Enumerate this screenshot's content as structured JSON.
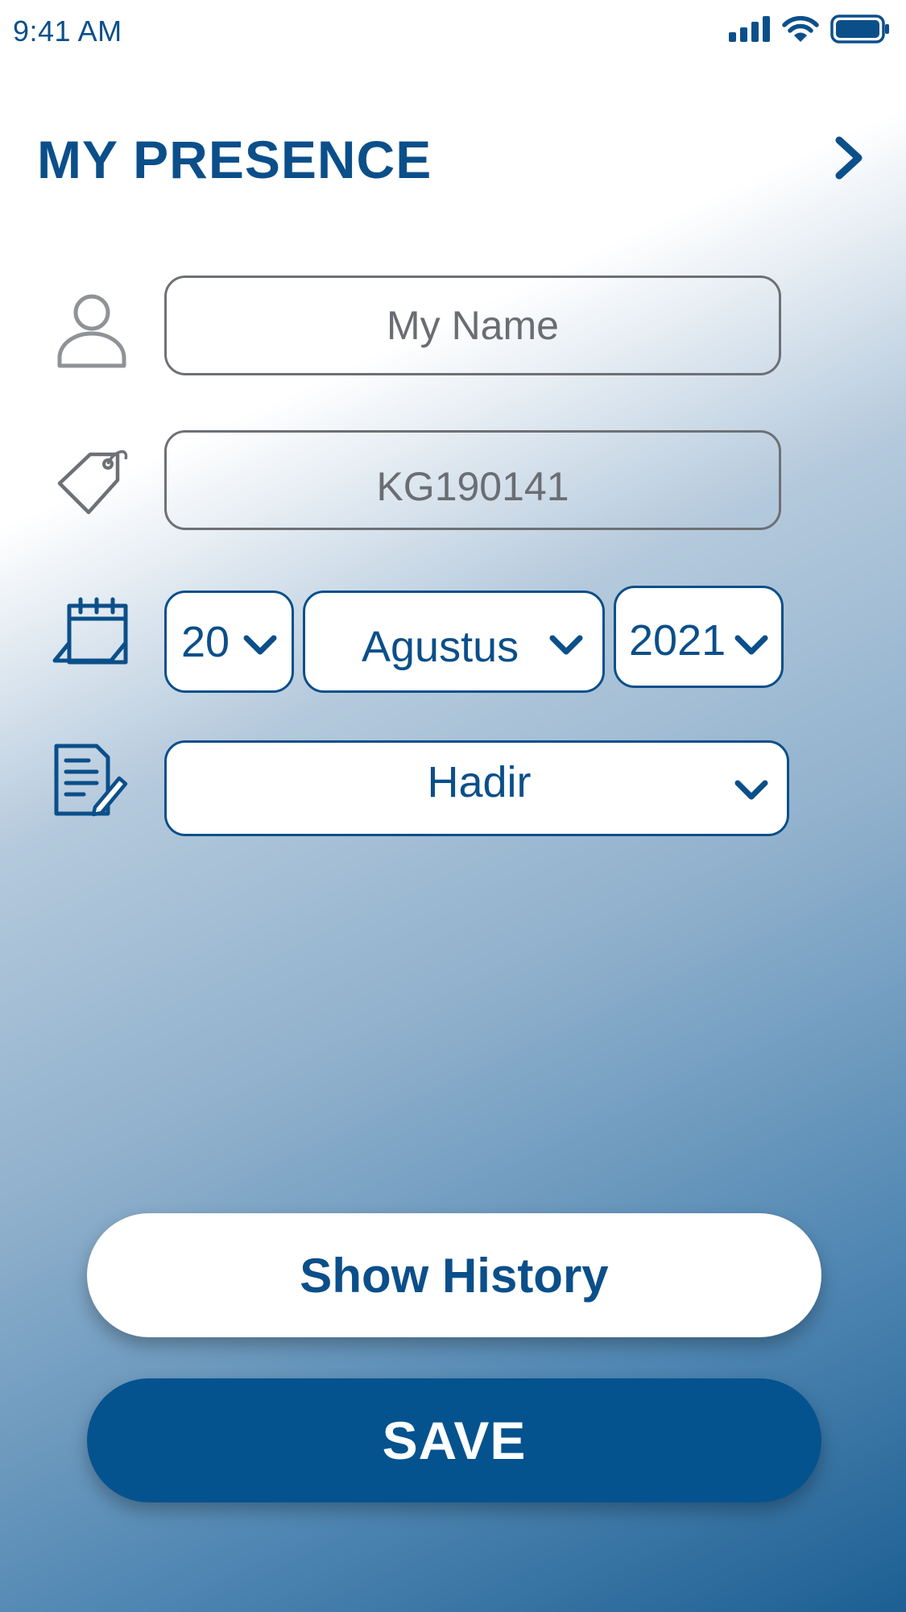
{
  "status_bar": {
    "time": "9:41 AM"
  },
  "header": {
    "title": "MY PRESENCE",
    "next_icon": "chevron-right-icon"
  },
  "form": {
    "name": {
      "icon": "person-icon",
      "placeholder": "My Name"
    },
    "id_tag": {
      "icon": "tag-icon",
      "value": "KG190141"
    },
    "date": {
      "icon": "calendar-icon",
      "day": "20",
      "month": "Agustus",
      "year": "2021"
    },
    "attendance": {
      "icon": "document-edit-icon",
      "value": "Hadir"
    }
  },
  "actions": {
    "history_label": "Show History",
    "save_label": "SAVE"
  },
  "colors": {
    "primary": "#0b4f8a",
    "save_button": "#04538f",
    "placeholder_text": "#6a6d72"
  }
}
